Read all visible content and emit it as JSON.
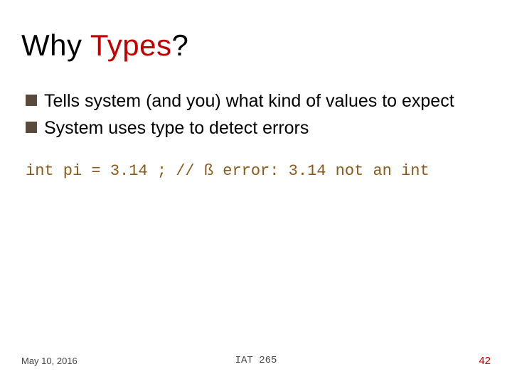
{
  "title": {
    "part1": "Why ",
    "accent": "Types",
    "part2": "?"
  },
  "bullets": [
    "Tells system (and you) what kind of values to expect",
    "System uses type to detect errors"
  ],
  "code": "int pi = 3.14 ; // ß error: 3.14 not an int",
  "footer": {
    "date": "May 10, 2016",
    "center": "IAT 265",
    "page": "42"
  }
}
